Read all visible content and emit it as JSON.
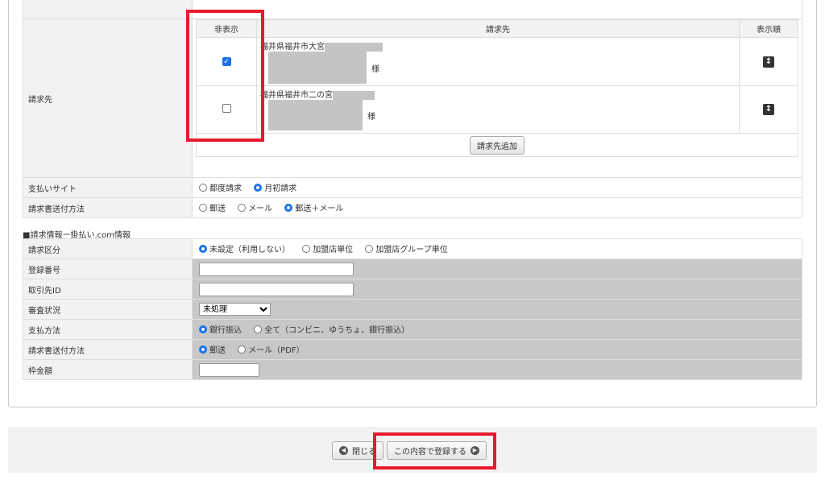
{
  "billing": {
    "label": "請求先",
    "headers": {
      "hide": "非表示",
      "destination": "請求先",
      "order": "表示順"
    },
    "rows": [
      {
        "hidden": true,
        "address": "福井県福井市大宮",
        "suffix": "様"
      },
      {
        "hidden": false,
        "address": "福井県福井市二の宮",
        "suffix": "様"
      }
    ],
    "add_button": "請求先追加"
  },
  "payment_site": {
    "label": "支払いサイト",
    "options": [
      "都度請求",
      "月初請求"
    ],
    "selected": 1
  },
  "invoice_method": {
    "label": "請求書送付方法",
    "options": [
      "郵送",
      "メール",
      "郵送＋メール"
    ],
    "selected": 2
  },
  "section2_title": "■請求情報ー掛払い.com情報",
  "kakebarai": {
    "billing_type": {
      "label": "請求区分",
      "options": [
        "未設定（利用しない）",
        "加盟店単位",
        "加盟店グループ単位"
      ],
      "selected": 0
    },
    "reg_number": {
      "label": "登録番号",
      "value": ""
    },
    "client_id": {
      "label": "取引先ID",
      "value": ""
    },
    "review": {
      "label": "審査状況",
      "value": "未処理"
    },
    "pay_method": {
      "label": "支払方法",
      "options": [
        "銀行振込",
        "全て（コンビニ、ゆうちょ、銀行振込）"
      ],
      "selected": 0
    },
    "invoice_method": {
      "label": "請求書送付方法",
      "options": [
        "郵送",
        "メール（PDF）"
      ],
      "selected": 0
    },
    "limit": {
      "label": "枠金額",
      "value": ""
    }
  },
  "footer": {
    "close": "閉じる",
    "submit": "この内容で登録する"
  }
}
